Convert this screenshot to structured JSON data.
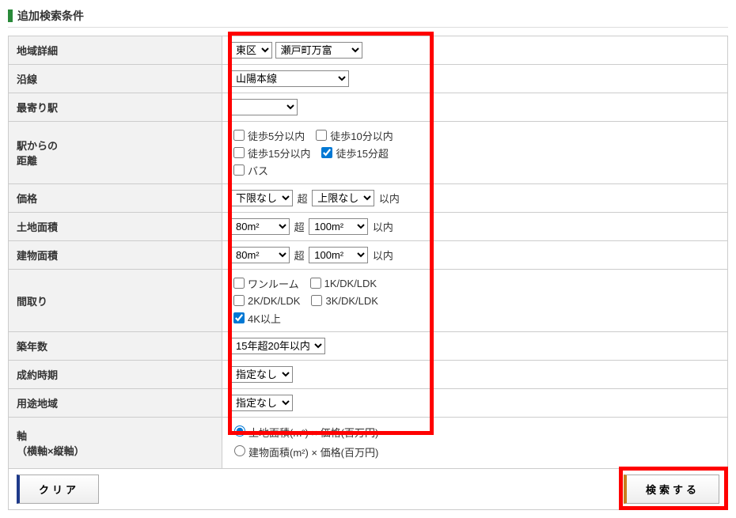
{
  "section_title": "追加検索条件",
  "labels": {
    "area_detail": "地域詳細",
    "line": "沿線",
    "nearest_station": "最寄り駅",
    "distance_from_station": "駅からの\n距離",
    "price": "価格",
    "land_area": "土地面積",
    "building_area": "建物面積",
    "layout": "間取り",
    "building_age": "築年数",
    "contract_period": "成約時期",
    "use_zone": "用途地域",
    "axis": "軸\n（横軸×縦軸）"
  },
  "area_detail": {
    "ward_selected": "東区",
    "town_selected": "瀬戸町万富"
  },
  "line": {
    "selected": "山陽本線"
  },
  "nearest_station": {
    "selected": ""
  },
  "distance": {
    "walk5": {
      "label": "徒歩5分以内",
      "checked": false
    },
    "walk10": {
      "label": "徒歩10分以内",
      "checked": false
    },
    "walk15": {
      "label": "徒歩15分以内",
      "checked": false
    },
    "walk15over": {
      "label": "徒歩15分超",
      "checked": true
    },
    "bus": {
      "label": "バス",
      "checked": false
    }
  },
  "price": {
    "lower_selected": "下限なし",
    "upper_selected": "上限なし",
    "between_low": "超",
    "between_high": "以内"
  },
  "land_area": {
    "lower_selected": "80m²",
    "upper_selected": "100m²",
    "between_low": "超",
    "between_high": "以内"
  },
  "building_area": {
    "lower_selected": "80m²",
    "upper_selected": "100m²",
    "between_low": "超",
    "between_high": "以内"
  },
  "layout": {
    "oneroom": {
      "label": "ワンルーム",
      "checked": false
    },
    "k1": {
      "label": "1K/DK/LDK",
      "checked": false
    },
    "k2": {
      "label": "2K/DK/LDK",
      "checked": false
    },
    "k3": {
      "label": "3K/DK/LDK",
      "checked": false
    },
    "k4": {
      "label": "4K以上",
      "checked": true
    }
  },
  "building_age": {
    "selected": "15年超20年以内"
  },
  "contract_period": {
    "selected": "指定なし"
  },
  "use_zone": {
    "selected": "指定なし"
  },
  "axis": {
    "land": {
      "label": "土地面積(m²) × 価格(百万円)",
      "checked": true
    },
    "building": {
      "label": "建物面積(m²) × 価格(百万円)",
      "checked": false
    }
  },
  "buttons": {
    "clear": "クリア",
    "search": "検索する"
  }
}
